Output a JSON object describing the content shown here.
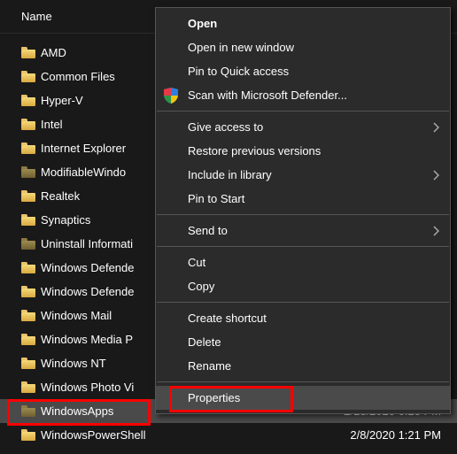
{
  "header": {
    "name_col": "Name"
  },
  "folders": [
    {
      "label": "AMD",
      "dim": false
    },
    {
      "label": "Common Files",
      "dim": false
    },
    {
      "label": "Hyper-V",
      "dim": false
    },
    {
      "label": "Intel",
      "dim": false
    },
    {
      "label": "Internet Explorer",
      "dim": false
    },
    {
      "label": "ModifiableWindo",
      "dim": true
    },
    {
      "label": "Realtek",
      "dim": false
    },
    {
      "label": "Synaptics",
      "dim": false
    },
    {
      "label": "Uninstall Informati",
      "dim": true
    },
    {
      "label": "Windows Defende",
      "dim": false
    },
    {
      "label": "Windows Defende",
      "dim": false
    },
    {
      "label": "Windows Mail",
      "dim": false
    },
    {
      "label": "Windows Media P",
      "dim": false
    },
    {
      "label": "Windows NT",
      "dim": false
    },
    {
      "label": "Windows Photo Vi",
      "dim": false
    },
    {
      "label": "WindowsApps",
      "dim": true,
      "selected": true,
      "date": "2/13/2020 6:13 PM"
    },
    {
      "label": "WindowsPowerShell",
      "dim": false,
      "date": "2/8/2020 1:21 PM"
    }
  ],
  "menu": {
    "open": "Open",
    "open_new_window": "Open in new window",
    "pin_quick_access": "Pin to Quick access",
    "scan_defender": "Scan with Microsoft Defender...",
    "give_access_to": "Give access to",
    "restore_versions": "Restore previous versions",
    "include_in_library": "Include in library",
    "pin_to_start": "Pin to Start",
    "send_to": "Send to",
    "cut": "Cut",
    "copy": "Copy",
    "create_shortcut": "Create shortcut",
    "delete": "Delete",
    "rename": "Rename",
    "properties": "Properties"
  }
}
